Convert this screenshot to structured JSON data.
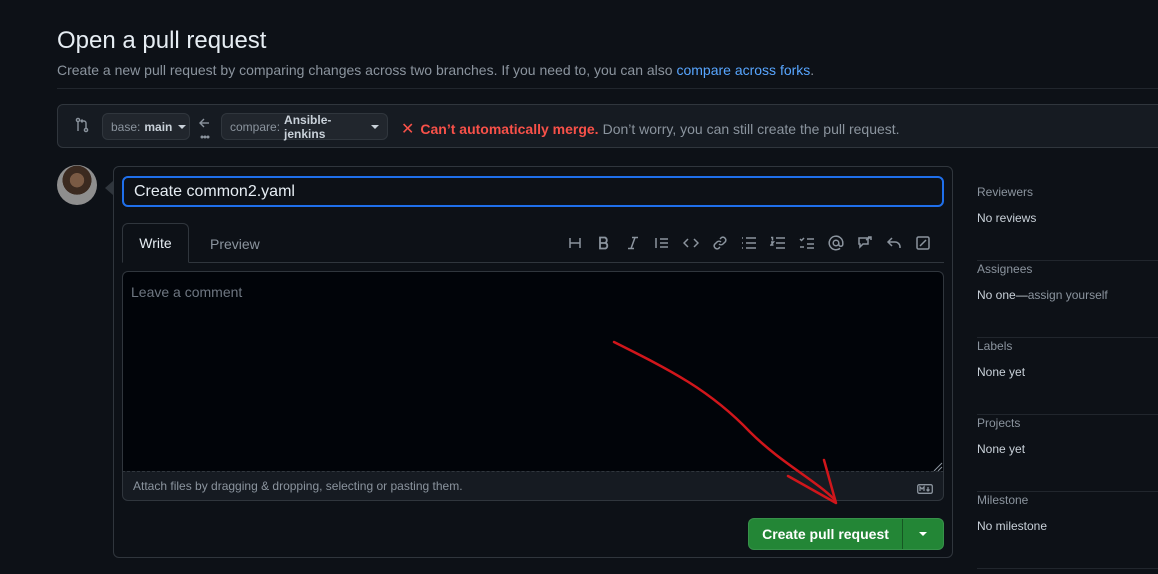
{
  "header": {
    "title": "Open a pull request",
    "subtitle_text": "Create a new pull request by comparing changes across two branches. If you need to, you can also ",
    "subtitle_link": "compare across forks",
    "subtitle_end": "."
  },
  "range": {
    "base_prefix": "base:",
    "base_branch": "main",
    "compare_prefix": "compare:",
    "compare_branch": "Ansible-jenkins",
    "merge_error": "Can’t automatically merge.",
    "merge_info": "Don’t worry, you can still create the pull request."
  },
  "form": {
    "title_value": "Create common2.yaml",
    "tab_write": "Write",
    "tab_preview": "Preview",
    "comment_placeholder": "Leave a comment",
    "attach_text": "Attach files by dragging & dropping, selecting or pasting them.",
    "create_button": "Create pull request"
  },
  "toolbar": {
    "icons": [
      "heading-icon",
      "bold-icon",
      "italic-icon",
      "quote-icon",
      "code-icon",
      "link-icon",
      "unordered-list-icon",
      "ordered-list-icon",
      "task-list-icon",
      "mention-icon",
      "cross-reference-icon",
      "reply-icon",
      "diff-icon"
    ]
  },
  "sidebar": {
    "reviewers_label": "Reviewers",
    "reviewers_value": "No reviews",
    "assignees_label": "Assignees",
    "assignees_value": "No one—",
    "assignees_link": "assign yourself",
    "labels_label": "Labels",
    "labels_value": "None yet",
    "projects_label": "Projects",
    "projects_value": "None yet",
    "milestone_label": "Milestone",
    "milestone_value": "No milestone"
  },
  "colors": {
    "background": "#0d1117",
    "accent_blue": "#58a6ff",
    "error_red": "#f85149",
    "button_green": "#238636",
    "annotation_red": "#d0161b"
  }
}
